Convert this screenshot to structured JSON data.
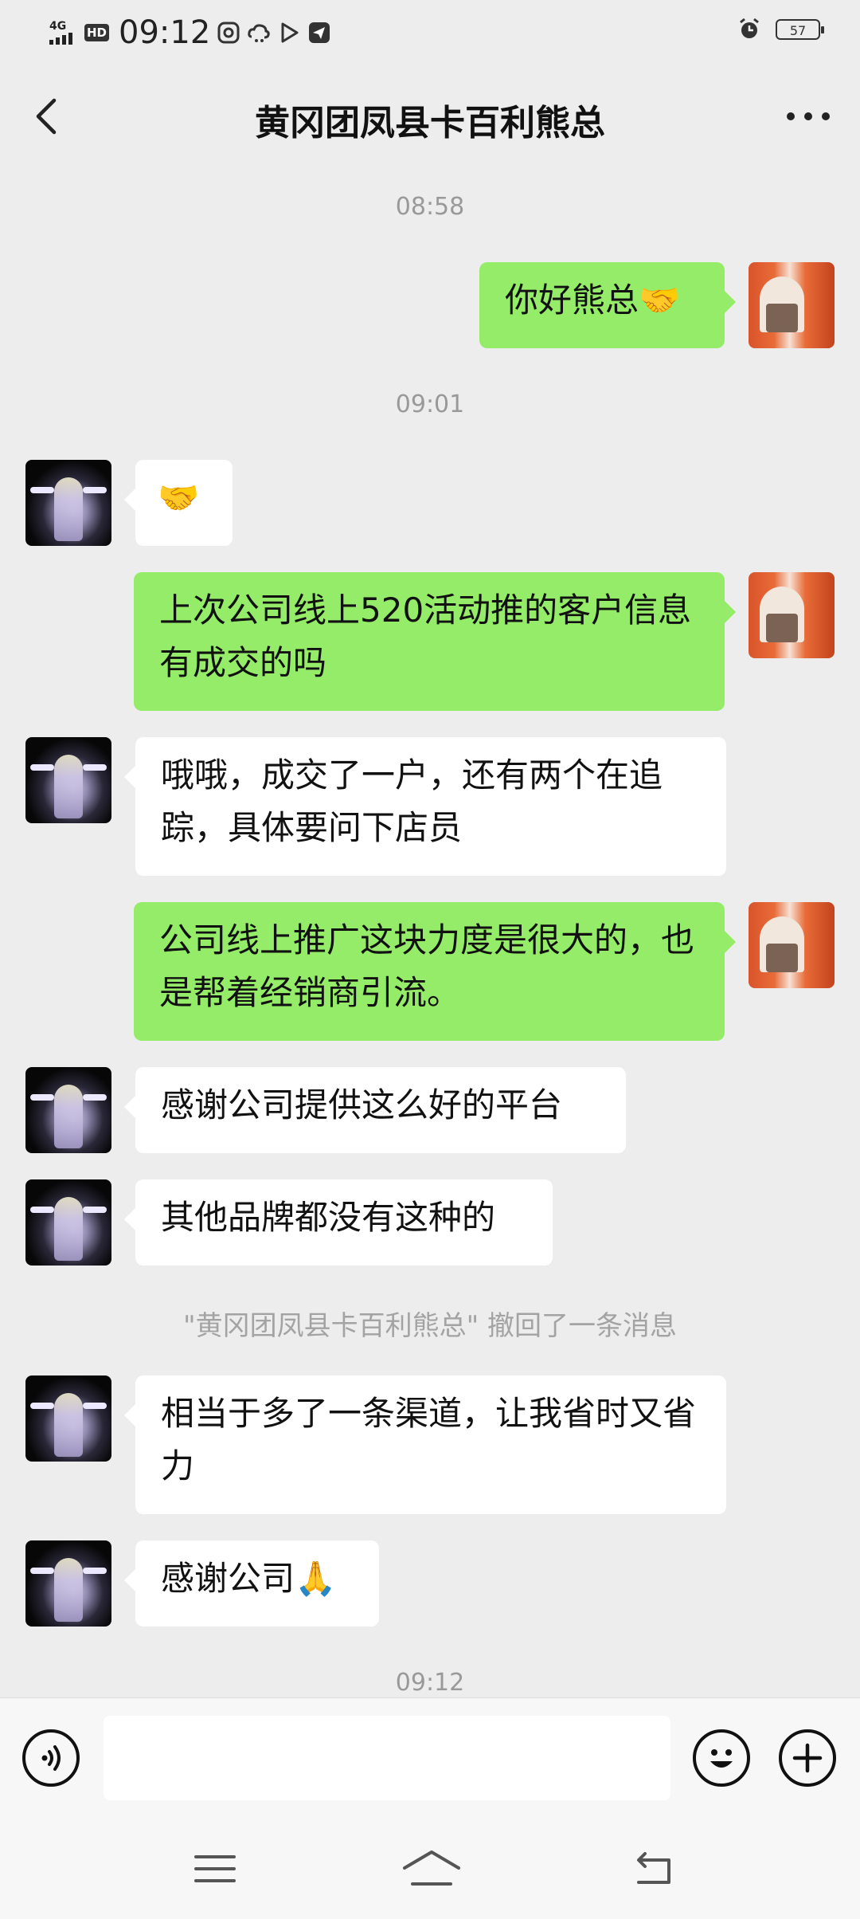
{
  "status_bar": {
    "network": "4G",
    "hd_badge": "HD",
    "time": "09:12",
    "battery": "57"
  },
  "header": {
    "title": "黄冈团凤县卡百利熊总"
  },
  "messages": [
    {
      "type": "time",
      "text": "08:58"
    },
    {
      "type": "out",
      "text": "你好熊总🤝"
    },
    {
      "type": "time",
      "text": "09:01"
    },
    {
      "type": "in",
      "text": "🤝"
    },
    {
      "type": "out",
      "text": "上次公司线上520活动推的客户信息有成交的吗"
    },
    {
      "type": "in",
      "text": "哦哦，成交了一户，还有两个在追踪，具体要问下店员"
    },
    {
      "type": "out",
      "text": "公司线上推广这块力度是很大的，也是帮着经销商引流。"
    },
    {
      "type": "in",
      "text": "感谢公司提供这么好的平台"
    },
    {
      "type": "in",
      "text": "其他品牌都没有这种的"
    },
    {
      "type": "system",
      "text": "\"黄冈团凤县卡百利熊总\" 撤回了一条消息"
    },
    {
      "type": "in",
      "text": "相当于多了一条渠道，让我省时又省力"
    },
    {
      "type": "in",
      "text": "感谢公司🙏"
    },
    {
      "type": "time",
      "text": "09:12"
    }
  ],
  "input": {
    "value": ""
  },
  "colors": {
    "background": "#ededed",
    "outgoing_bubble": "#95ec69",
    "incoming_bubble": "#ffffff",
    "timestamp": "#999999"
  },
  "icons": {
    "back": "chevron-left-icon",
    "more": "more-dots-icon",
    "voice": "voice-icon",
    "emoji": "emoji-icon",
    "plus": "plus-icon"
  }
}
